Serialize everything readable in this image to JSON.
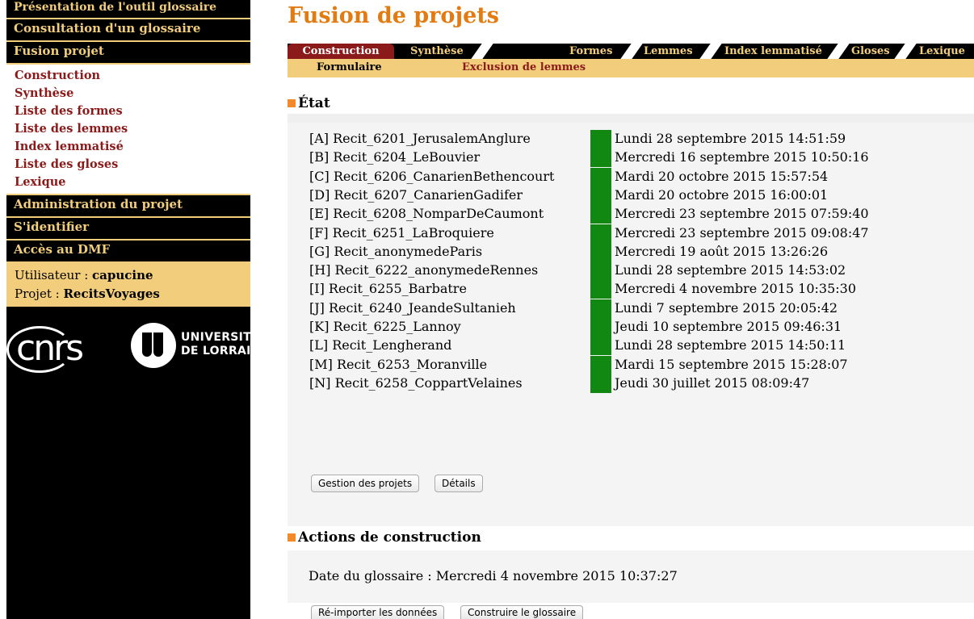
{
  "sidebar": {
    "menu": {
      "presentation": "Présentation de l'outil glossaire",
      "consultation": "Consultation d'un glossaire",
      "fusion": "Fusion projet"
    },
    "submenu": [
      "Construction",
      "Synthèse",
      "Liste des formes",
      "Liste des lemmes",
      "Index lemmatisé",
      "Liste des gloses",
      "Lexique"
    ],
    "menu2": {
      "admin": "Administration du projet",
      "login": "S'identifier",
      "dmf": "Accès au DMF"
    },
    "user_label": "Utilisateur : ",
    "user_value": "capucine",
    "project_label": "Projet : ",
    "project_value": "RecitsVoyages",
    "logo_cnrs": "cnrs",
    "logo_univ_line1": "UNIVERSITÉ",
    "logo_univ_line2": "DE LORRAINE"
  },
  "page_title": "Fusion de projets",
  "tabs": [
    "Construction",
    "Synthèse",
    "Formes",
    "Lemmes",
    "Index lemmatisé",
    "Gloses",
    "Lexique"
  ],
  "subtabs": [
    "Formulaire",
    "Exclusion de lemmes"
  ],
  "state": {
    "title": "État",
    "status_color": "#118811",
    "rows": [
      {
        "label": "[A] Recit_6201_JerusalemAnglure",
        "date": "Lundi 28 septembre 2015 14:51:59"
      },
      {
        "label": "[B] Recit_6204_LeBouvier",
        "date": "Mercredi 16 septembre 2015 10:50:16"
      },
      {
        "label": "[C] Recit_6206_CanarienBethencourt",
        "date": "Mardi 20 octobre 2015 15:57:54"
      },
      {
        "label": "[D] Recit_6207_CanarienGadifer",
        "date": "Mardi 20 octobre 2015 16:00:01"
      },
      {
        "label": "[E] Recit_6208_NomparDeCaumont",
        "date": "Mercredi 23 septembre 2015 07:59:40"
      },
      {
        "label": "[F] Recit_6251_LaBroquiere",
        "date": "Mercredi 23 septembre 2015 09:08:47"
      },
      {
        "label": "[G] Recit_anonymedeParis",
        "date": "Mercredi 19 août 2015 13:26:26"
      },
      {
        "label": "[H] Recit_6222_anonymedeRennes",
        "date": "Lundi 28 septembre 2015 14:53:02"
      },
      {
        "label": "[I] Recit_6255_Barbatre",
        "date": "Mercredi 4 novembre 2015 10:35:30"
      },
      {
        "label": "[J] Recit_6240_JeandeSultanieh",
        "date": "Lundi 7 septembre 2015 20:05:42"
      },
      {
        "label": "[K] Recit_6225_Lannoy",
        "date": "Jeudi 10 septembre 2015 09:46:31"
      },
      {
        "label": "[L] Recit_Lengherand",
        "date": "Lundi 28 septembre 2015 14:50:11"
      },
      {
        "label": "[M] Recit_6253_Moranville",
        "date": "Mardi 15 septembre 2015 15:28:07"
      },
      {
        "label": "[N] Recit_6258_CoppartVelaines",
        "date": "Jeudi 30 juillet 2015 08:09:47"
      }
    ],
    "buttons": {
      "manage": "Gestion des projets",
      "details": "Détails"
    }
  },
  "actions": {
    "title": "Actions de construction",
    "date_line": "Date du glossaire : Mercredi 4 novembre 2015 10:37:27",
    "buttons": {
      "reimport": "Ré-importer les données",
      "build": "Construire le glossaire"
    }
  },
  "colors": {
    "accent_orange": "#e27b12",
    "menu_gold": "#f1cd7c",
    "menu_red": "#8b1a1a"
  }
}
